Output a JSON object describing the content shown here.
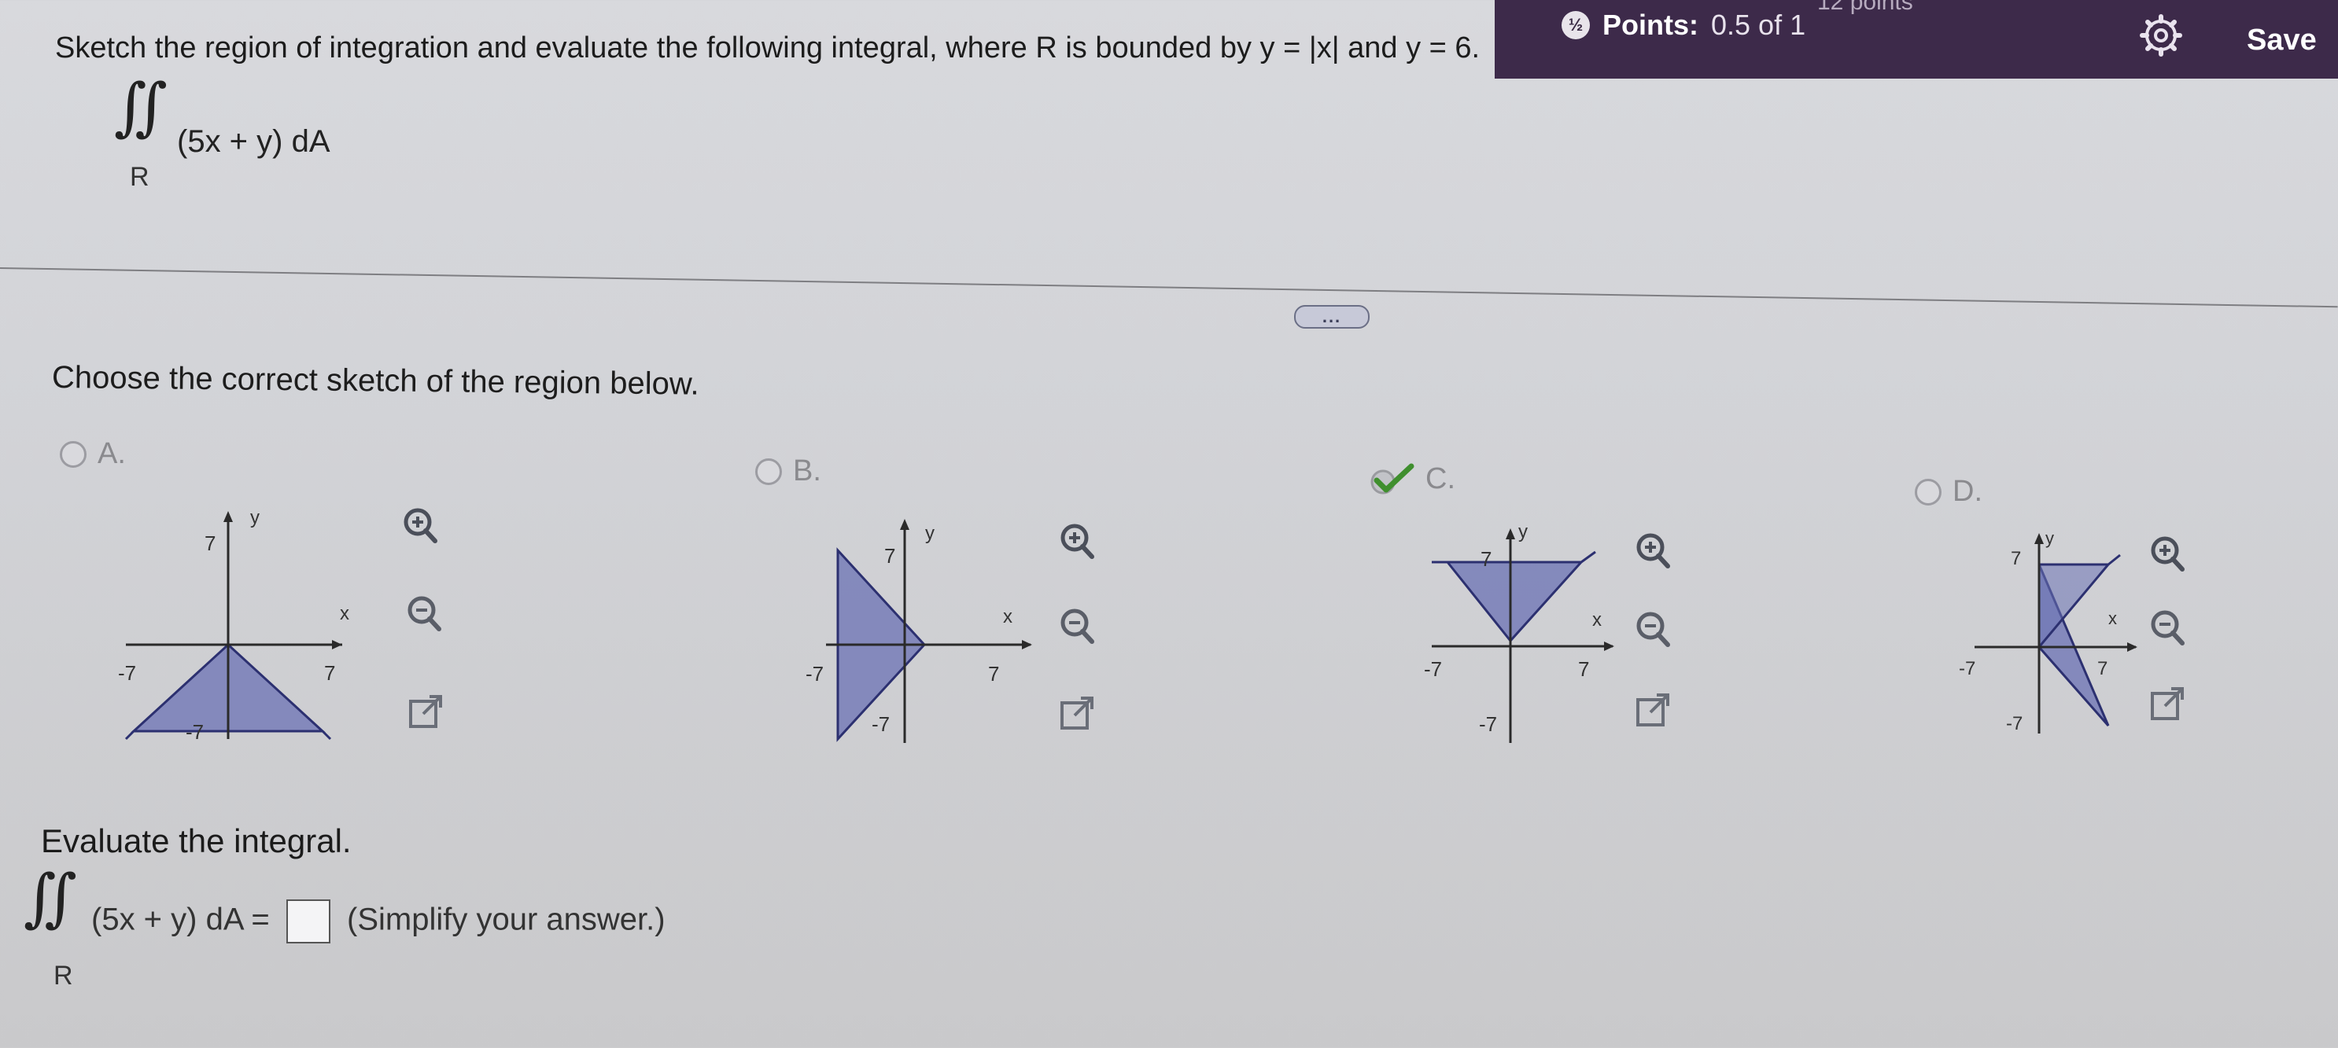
{
  "header": {
    "top_cut_text": "12 points",
    "points_label": "Points:",
    "points_value": "0.5 of 1",
    "points_icon_glyph": "½",
    "save_label": "Save"
  },
  "question": {
    "prompt": "Sketch the region of integration and evaluate the following integral, where R is bounded by y = |x| and y = 6.",
    "integral_symbol": "∬",
    "integrand": "(5x + y) dA",
    "region": "R"
  },
  "expand_button": "...",
  "part1": {
    "instruction": "Choose the correct sketch of the region below.",
    "options": [
      {
        "label": "A.",
        "selected": false,
        "y_label": "y",
        "x_label": "x",
        "tick_pos": "7",
        "tick_neg": "-7"
      },
      {
        "label": "B.",
        "selected": false,
        "y_label": "y",
        "x_label": "x",
        "tick_pos": "7",
        "tick_neg": "-7"
      },
      {
        "label": "C.",
        "selected": true,
        "y_label": "y",
        "x_label": "x",
        "tick_pos": "7",
        "tick_neg": "-7"
      },
      {
        "label": "D.",
        "selected": false,
        "y_label": "y",
        "x_label": "x",
        "tick_pos": "7",
        "tick_neg": "-7"
      }
    ]
  },
  "part2": {
    "instruction": "Evaluate the integral.",
    "integral_symbol": "∬",
    "integrand": "(5x + y) dA =",
    "region": "R",
    "answer_value": "",
    "hint": "(Simplify your answer.)"
  },
  "colors": {
    "header_bg": "#3d2a4a",
    "region_fill": "#6b72b4",
    "check_green": "#3f8f2e"
  },
  "icons": [
    "points-icon",
    "gear-icon",
    "zoom-in-icon",
    "zoom-out-icon",
    "popout-icon",
    "check-icon"
  ]
}
